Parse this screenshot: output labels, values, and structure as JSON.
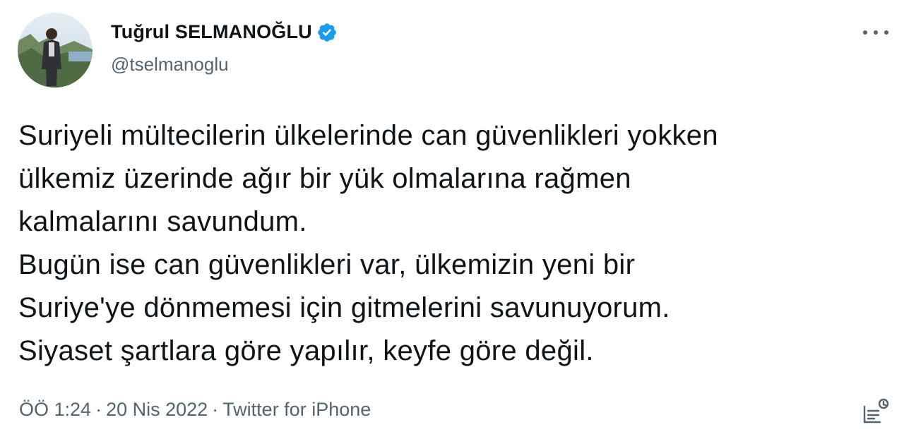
{
  "author": {
    "display_name": "Tuğrul SELMANOĞLU",
    "handle": "@tselmanoglu",
    "verified": true,
    "avatar_icon": "profile-photo"
  },
  "tweet": {
    "lines": [
      "Suriyeli mültecilerin ülkelerinde can güvenlikleri yokken",
      "ülkemiz üzerinde ağır bir yük olmalarına rağmen",
      "kalmalarını savundum.",
      "Bugün ise can güvenlikleri var, ülkemizin yeni bir",
      "Suriye'ye dönmemesi için gitmelerini savunuyorum.",
      "Siyaset şartlara göre yapılır, keyfe göre değil."
    ]
  },
  "meta": {
    "time": "ÖÖ 1:24",
    "separator": "·",
    "date": "20 Nis 2022",
    "source": "Twitter for iPhone"
  },
  "icons": {
    "verified": "verified-badge-icon",
    "more": "more-options-icon",
    "analytics": "analytics-icon"
  },
  "colors": {
    "text": "#0f1419",
    "secondary": "#536471",
    "verified": "#1d9bf0"
  }
}
